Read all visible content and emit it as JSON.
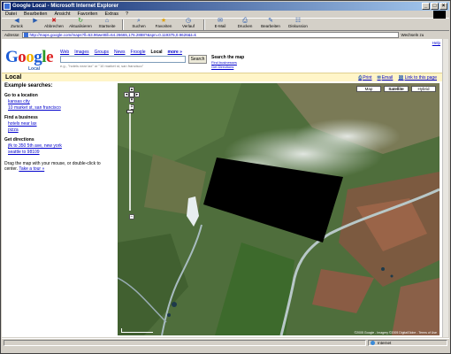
{
  "window": {
    "title": "Google Local - Microsoft Internet Explorer",
    "buttons": [
      "_",
      "□",
      "×"
    ]
  },
  "menu": [
    "Datei",
    "Bearbeiten",
    "Ansicht",
    "Favoriten",
    "Extras",
    "?"
  ],
  "toolbar": [
    {
      "label": "Zurück",
      "icon": "back-arrow-icon",
      "glyph": "◀"
    },
    {
      "label": "",
      "icon": "forward-arrow-icon",
      "glyph": "▶"
    },
    {
      "label": "Abbrechen",
      "icon": "stop-icon",
      "glyph": "✖"
    },
    {
      "label": "Aktualisieren",
      "icon": "refresh-icon",
      "glyph": "↻"
    },
    {
      "label": "Startseite",
      "icon": "home-icon",
      "glyph": "⌂"
    },
    {
      "label": "Suchen",
      "icon": "search-icon",
      "glyph": "⌕"
    },
    {
      "label": "Favoriten",
      "icon": "favorites-icon",
      "glyph": "★"
    },
    {
      "label": "Verlauf",
      "icon": "history-icon",
      "glyph": "◷"
    },
    {
      "label": "E-Mail",
      "icon": "mail-icon",
      "glyph": "✉"
    },
    {
      "label": "Drucken",
      "icon": "print-icon",
      "glyph": "⎙"
    },
    {
      "label": "Bearbeiten",
      "icon": "edit-icon",
      "glyph": "✎"
    },
    {
      "label": "Diskussion",
      "icon": "discuss-icon",
      "glyph": "☷"
    }
  ],
  "address": {
    "label": "Adresse",
    "url": "http://maps.google.com/maps?ll=63.96wet6ll=64.26665,176.2888?&spn=0.119375,0.9626&t=k",
    "go": "Wechseln zu"
  },
  "help": "Help",
  "logo": {
    "text_parts": [
      "G",
      "o",
      "o",
      "g",
      "l",
      "e"
    ],
    "sub": "Local"
  },
  "nav": {
    "web": "Web",
    "images": "Images",
    "groups": "Groups",
    "news": "News",
    "froogle": "Froogle",
    "local": "Local",
    "more": "more »"
  },
  "search": {
    "button": "Search",
    "hint": "e.g., \"hotels near lax\" or \"10 market st, san francisco\"",
    "title": "Search the map",
    "find_business": "Find businesses",
    "get_directions": "Get Directions"
  },
  "localbar": {
    "title": "Local",
    "print": "Print",
    "email": "Email",
    "link": "Link to this page"
  },
  "left": {
    "title": "Example searches:",
    "sections": [
      {
        "heading": "Go to a location",
        "links": [
          "kansas city",
          "10 market st, san francisco"
        ]
      },
      {
        "heading": "Find a business",
        "links": [
          "hotels near lax",
          "pizza"
        ]
      },
      {
        "heading": "Get directions",
        "links": [
          "jfk to 350 5th ave, new york",
          "seattle to 98109"
        ]
      }
    ],
    "drag_text": "Drag the map with your mouse, or double-click to center.",
    "tour": "Take a tour »"
  },
  "map": {
    "types": [
      "Map",
      "Satellite",
      "Hybrid"
    ],
    "active_type": "Satellite",
    "attribution": "©2005 Google - Imagery ©2005 DigitalGlobe - Terms of Use",
    "zoom_in": "+",
    "zoom_out": "−"
  },
  "status": {
    "zone": "Internet"
  },
  "colors": {
    "accent": "#1a5bd6",
    "localbar": "#fff5c8"
  }
}
